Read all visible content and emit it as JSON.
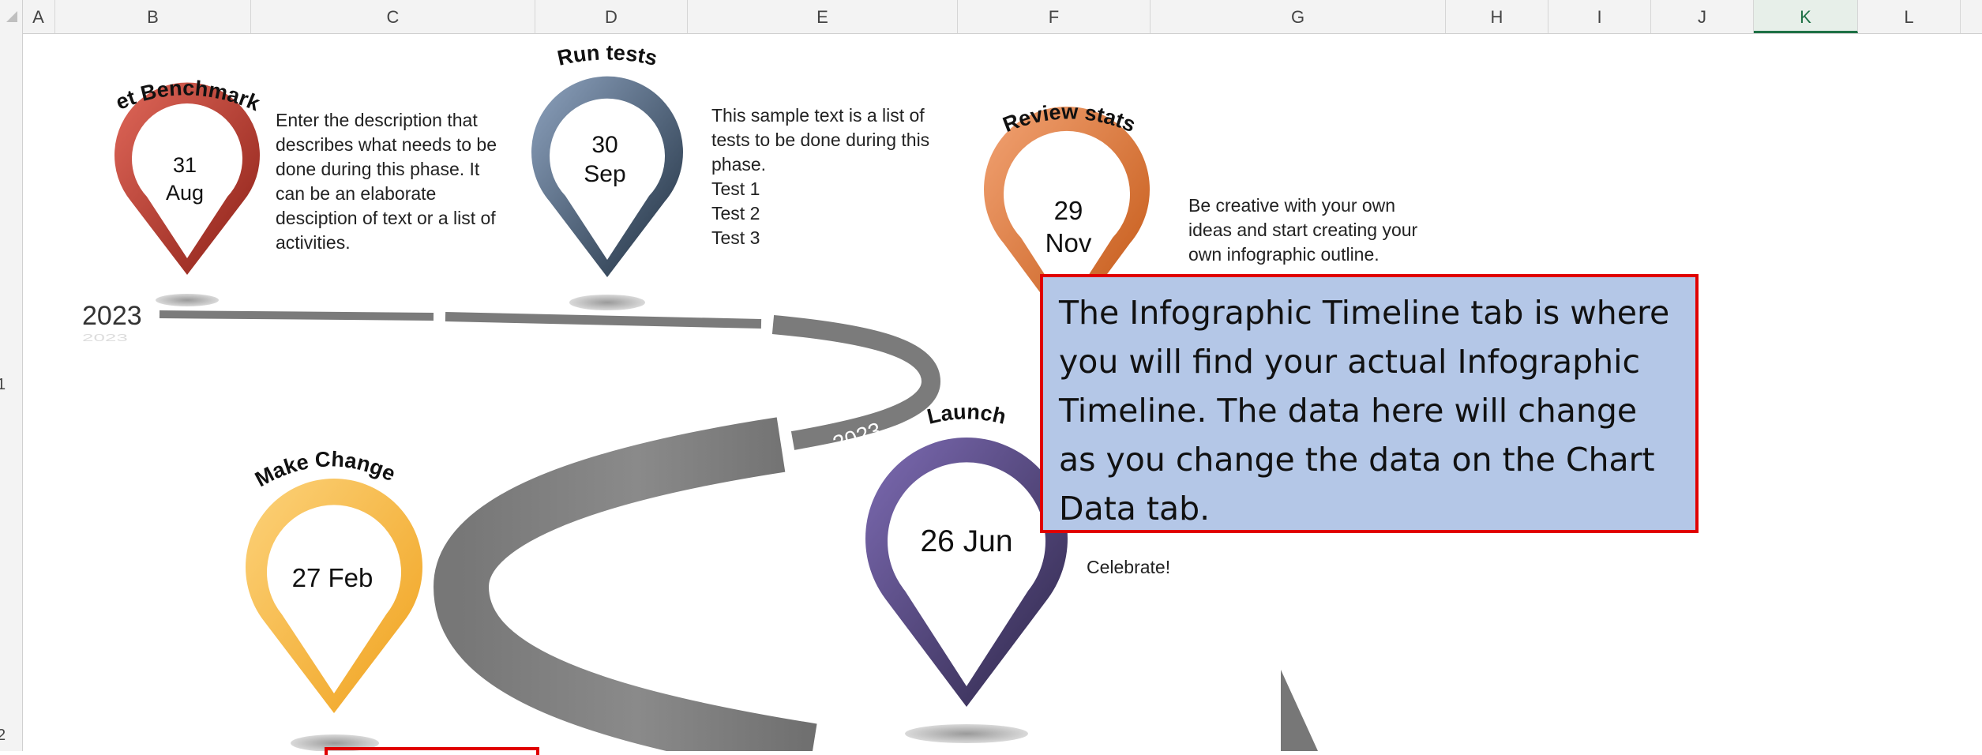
{
  "columns": [
    "A",
    "B",
    "C",
    "D",
    "E",
    "F",
    "G",
    "H",
    "I",
    "J",
    "K",
    "L"
  ],
  "active_column": "K",
  "rows": [
    "1",
    "2"
  ],
  "timeline": {
    "year_start": "2023",
    "year_start_reflection": "2023",
    "year_curve": "2023"
  },
  "phases": [
    {
      "title": "Set Benchmarks",
      "day": "31",
      "month": "Aug",
      "color_light": "#e0685a",
      "color_dark": "#8c1f16",
      "description": [
        "Enter the description that",
        "describes what needs to be",
        "done during this phase. It",
        "can be an elaborate",
        "desciption of text or a list of",
        "activities."
      ]
    },
    {
      "title": "Run tests",
      "day": "30",
      "month": "Sep",
      "color_light": "#8ea3bf",
      "color_dark": "#1f2f40",
      "description": [
        "This sample text is a list of",
        "tests to be done during this",
        "phase.",
        "Test 1",
        "Test 2",
        "Test 3"
      ]
    },
    {
      "title": "Review  stats",
      "day": "29",
      "month": "Nov",
      "color_light": "#f2a374",
      "color_dark": "#c25512",
      "description": [
        "Be creative with your own",
        "ideas and start creating your",
        "own infographic outline."
      ]
    },
    {
      "title": "Make Changes",
      "date": "27 Feb",
      "color_light": "#fcd27a",
      "color_dark": "#f0a21e",
      "description": []
    },
    {
      "title": "Launch",
      "date": "26 Jun",
      "color_light": "#7d6bb3",
      "color_dark": "#2d2648",
      "description": [
        "Celebrate!"
      ]
    }
  ],
  "callout": {
    "text": "The Infographic Timeline tab is where you will find your actual Infographic Timeline. The data here will change as you change the data on the Chart Data tab.",
    "background": "#b4c7e7",
    "border": "#e00000"
  }
}
